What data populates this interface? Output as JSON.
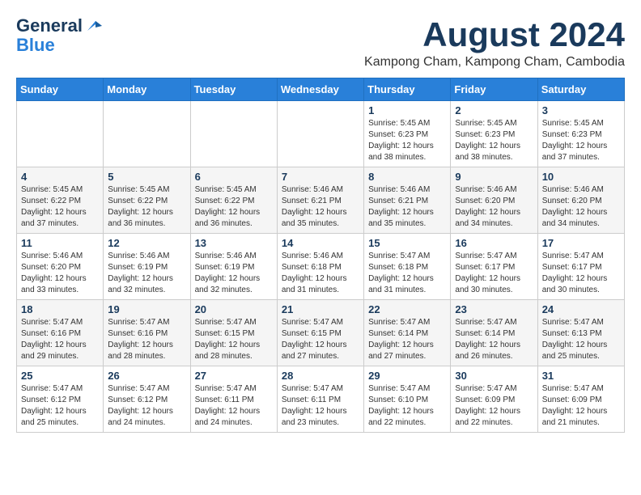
{
  "logo": {
    "line1": "General",
    "line2": "Blue"
  },
  "title": {
    "month_year": "August 2024",
    "location": "Kampong Cham, Kampong Cham, Cambodia"
  },
  "days_of_week": [
    "Sunday",
    "Monday",
    "Tuesday",
    "Wednesday",
    "Thursday",
    "Friday",
    "Saturday"
  ],
  "weeks": [
    [
      {
        "day": "",
        "info": ""
      },
      {
        "day": "",
        "info": ""
      },
      {
        "day": "",
        "info": ""
      },
      {
        "day": "",
        "info": ""
      },
      {
        "day": "1",
        "info": "Sunrise: 5:45 AM\nSunset: 6:23 PM\nDaylight: 12 hours\nand 38 minutes."
      },
      {
        "day": "2",
        "info": "Sunrise: 5:45 AM\nSunset: 6:23 PM\nDaylight: 12 hours\nand 38 minutes."
      },
      {
        "day": "3",
        "info": "Sunrise: 5:45 AM\nSunset: 6:23 PM\nDaylight: 12 hours\nand 37 minutes."
      }
    ],
    [
      {
        "day": "4",
        "info": "Sunrise: 5:45 AM\nSunset: 6:22 PM\nDaylight: 12 hours\nand 37 minutes."
      },
      {
        "day": "5",
        "info": "Sunrise: 5:45 AM\nSunset: 6:22 PM\nDaylight: 12 hours\nand 36 minutes."
      },
      {
        "day": "6",
        "info": "Sunrise: 5:45 AM\nSunset: 6:22 PM\nDaylight: 12 hours\nand 36 minutes."
      },
      {
        "day": "7",
        "info": "Sunrise: 5:46 AM\nSunset: 6:21 PM\nDaylight: 12 hours\nand 35 minutes."
      },
      {
        "day": "8",
        "info": "Sunrise: 5:46 AM\nSunset: 6:21 PM\nDaylight: 12 hours\nand 35 minutes."
      },
      {
        "day": "9",
        "info": "Sunrise: 5:46 AM\nSunset: 6:20 PM\nDaylight: 12 hours\nand 34 minutes."
      },
      {
        "day": "10",
        "info": "Sunrise: 5:46 AM\nSunset: 6:20 PM\nDaylight: 12 hours\nand 34 minutes."
      }
    ],
    [
      {
        "day": "11",
        "info": "Sunrise: 5:46 AM\nSunset: 6:20 PM\nDaylight: 12 hours\nand 33 minutes."
      },
      {
        "day": "12",
        "info": "Sunrise: 5:46 AM\nSunset: 6:19 PM\nDaylight: 12 hours\nand 32 minutes."
      },
      {
        "day": "13",
        "info": "Sunrise: 5:46 AM\nSunset: 6:19 PM\nDaylight: 12 hours\nand 32 minutes."
      },
      {
        "day": "14",
        "info": "Sunrise: 5:46 AM\nSunset: 6:18 PM\nDaylight: 12 hours\nand 31 minutes."
      },
      {
        "day": "15",
        "info": "Sunrise: 5:47 AM\nSunset: 6:18 PM\nDaylight: 12 hours\nand 31 minutes."
      },
      {
        "day": "16",
        "info": "Sunrise: 5:47 AM\nSunset: 6:17 PM\nDaylight: 12 hours\nand 30 minutes."
      },
      {
        "day": "17",
        "info": "Sunrise: 5:47 AM\nSunset: 6:17 PM\nDaylight: 12 hours\nand 30 minutes."
      }
    ],
    [
      {
        "day": "18",
        "info": "Sunrise: 5:47 AM\nSunset: 6:16 PM\nDaylight: 12 hours\nand 29 minutes."
      },
      {
        "day": "19",
        "info": "Sunrise: 5:47 AM\nSunset: 6:16 PM\nDaylight: 12 hours\nand 28 minutes."
      },
      {
        "day": "20",
        "info": "Sunrise: 5:47 AM\nSunset: 6:15 PM\nDaylight: 12 hours\nand 28 minutes."
      },
      {
        "day": "21",
        "info": "Sunrise: 5:47 AM\nSunset: 6:15 PM\nDaylight: 12 hours\nand 27 minutes."
      },
      {
        "day": "22",
        "info": "Sunrise: 5:47 AM\nSunset: 6:14 PM\nDaylight: 12 hours\nand 27 minutes."
      },
      {
        "day": "23",
        "info": "Sunrise: 5:47 AM\nSunset: 6:14 PM\nDaylight: 12 hours\nand 26 minutes."
      },
      {
        "day": "24",
        "info": "Sunrise: 5:47 AM\nSunset: 6:13 PM\nDaylight: 12 hours\nand 25 minutes."
      }
    ],
    [
      {
        "day": "25",
        "info": "Sunrise: 5:47 AM\nSunset: 6:12 PM\nDaylight: 12 hours\nand 25 minutes."
      },
      {
        "day": "26",
        "info": "Sunrise: 5:47 AM\nSunset: 6:12 PM\nDaylight: 12 hours\nand 24 minutes."
      },
      {
        "day": "27",
        "info": "Sunrise: 5:47 AM\nSunset: 6:11 PM\nDaylight: 12 hours\nand 24 minutes."
      },
      {
        "day": "28",
        "info": "Sunrise: 5:47 AM\nSunset: 6:11 PM\nDaylight: 12 hours\nand 23 minutes."
      },
      {
        "day": "29",
        "info": "Sunrise: 5:47 AM\nSunset: 6:10 PM\nDaylight: 12 hours\nand 22 minutes."
      },
      {
        "day": "30",
        "info": "Sunrise: 5:47 AM\nSunset: 6:09 PM\nDaylight: 12 hours\nand 22 minutes."
      },
      {
        "day": "31",
        "info": "Sunrise: 5:47 AM\nSunset: 6:09 PM\nDaylight: 12 hours\nand 21 minutes."
      }
    ]
  ]
}
